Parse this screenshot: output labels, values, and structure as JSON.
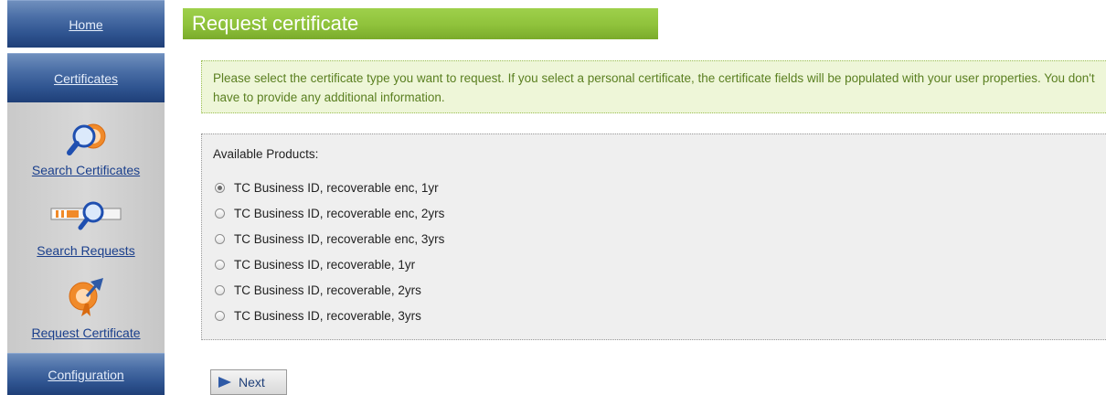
{
  "sidebar": {
    "home": "Home",
    "certificates": "Certificates",
    "tools": [
      {
        "label": "Search Certificates",
        "icon": "search-certificates-icon"
      },
      {
        "label": "Search Requests",
        "icon": "search-requests-icon"
      },
      {
        "label": "Request Certificate",
        "icon": "request-certificate-icon"
      }
    ],
    "configuration": "Configuration"
  },
  "page": {
    "title": "Request certificate",
    "info": "Please select the certificate type you want to request. If you select a personal certificate, the certificate fields will be populated with your user properties. You don't have to provide any additional information."
  },
  "products": {
    "header": "Available Products:",
    "selected_index": 0,
    "options": [
      "TC Business ID, recoverable enc, 1yr",
      "TC Business ID, recoverable enc, 2yrs",
      "TC Business ID, recoverable enc, 3yrs",
      "TC Business ID, recoverable, 1yr",
      "TC Business ID, recoverable, 2yrs",
      "TC Business ID, recoverable, 3yrs"
    ]
  },
  "actions": {
    "next": "Next"
  },
  "colors": {
    "nav_blue": "#2f5490",
    "title_green": "#8fc23b",
    "info_bg": "#eef6d8",
    "info_text": "#5a7f20",
    "link_blue": "#1a3f8c"
  }
}
